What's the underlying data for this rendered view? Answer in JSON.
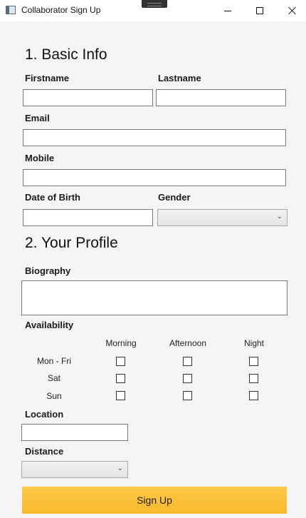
{
  "window": {
    "title": "Collaborator Sign Up"
  },
  "section1": {
    "heading": "1. Basic Info"
  },
  "fields": {
    "firstname": {
      "label": "Firstname",
      "value": ""
    },
    "lastname": {
      "label": "Lastname",
      "value": ""
    },
    "email": {
      "label": "Email",
      "value": ""
    },
    "mobile": {
      "label": "Mobile",
      "value": ""
    },
    "dob": {
      "label": "Date of Birth",
      "value": ""
    },
    "gender": {
      "label": "Gender",
      "selected": ""
    }
  },
  "section2": {
    "heading": "2. Your Profile"
  },
  "profile": {
    "biography_label": "Biography",
    "availability_label": "Availability",
    "columns": [
      "Morning",
      "Afternoon",
      "Night"
    ],
    "days": [
      "Mon - Fri",
      "Sat",
      "Sun"
    ],
    "checked": [
      [
        false,
        false,
        false
      ],
      [
        false,
        false,
        false
      ],
      [
        false,
        false,
        false
      ]
    ],
    "location_label": "Location",
    "distance_label": "Distance"
  },
  "signup_label": "Sign Up",
  "icons": {
    "dropdown": "chevron-down-icon",
    "chevron_glyph": "⌄"
  },
  "colors": {
    "button": "#f8b92c",
    "background": "#f3f5f6"
  }
}
